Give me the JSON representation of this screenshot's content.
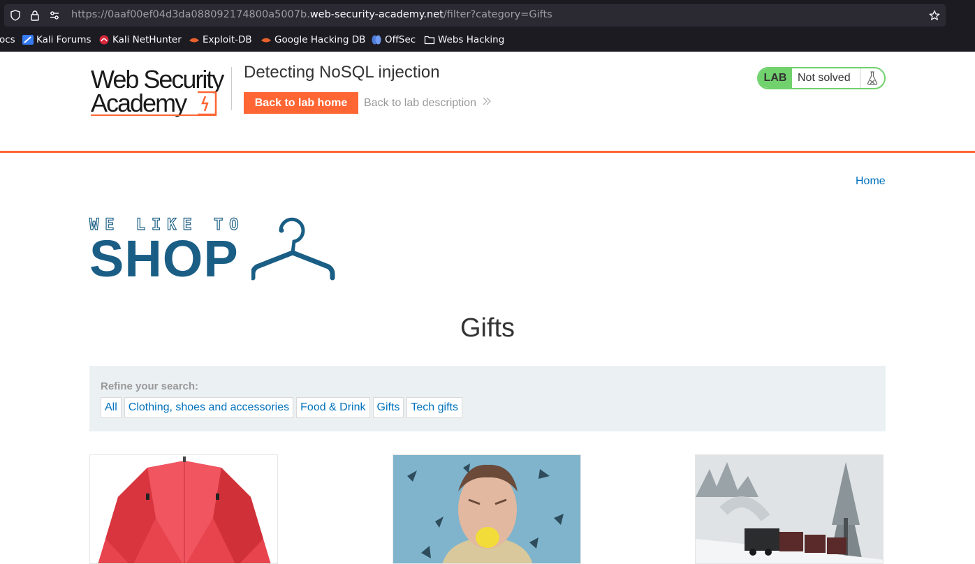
{
  "browser": {
    "url_prefix": "https://0aaf00ef04d3da088092174800a5007b.",
    "url_host": "web-security-academy.net",
    "url_path": "/filter?category=Gifts",
    "bookmarks": [
      {
        "label": "ocs",
        "icon": "truncated-docs"
      },
      {
        "label": "Kali Forums",
        "icon": "kali-forums-icon"
      },
      {
        "label": "Kali NetHunter",
        "icon": "kali-nethunter-icon"
      },
      {
        "label": "Exploit-DB",
        "icon": "exploit-db-icon"
      },
      {
        "label": "Google Hacking DB",
        "icon": "google-hacking-db-icon"
      },
      {
        "label": "OffSec",
        "icon": "offsec-icon"
      },
      {
        "label": "Webs Hacking",
        "icon": "folder-icon"
      }
    ]
  },
  "lab": {
    "logo_line1": "Web Security",
    "logo_line2": "Academy",
    "title": "Detecting NoSQL injection",
    "back_home": "Back to lab home",
    "back_description": "Back to lab description",
    "badge": "LAB",
    "status": "Not solved",
    "colors": {
      "accent": "#ff6633",
      "badge": "#70d16d"
    }
  },
  "shop": {
    "home_link": "Home",
    "logo_tagline": "WE LIKE TO",
    "logo_word": "SHOP",
    "heading": "Gifts",
    "refine_label": "Refine your search:",
    "filters": [
      "All",
      "Clothing, shoes and accessories",
      "Food & Drink",
      "Gifts",
      "Tech gifts"
    ],
    "products": [
      {
        "image": "red-umbrella"
      },
      {
        "image": "man-biting-lemon"
      },
      {
        "image": "snowy-steam-train"
      }
    ],
    "colors": {
      "link": "#0071bc",
      "logo": "#1a5e85",
      "panel": "#ebf0f2"
    }
  }
}
